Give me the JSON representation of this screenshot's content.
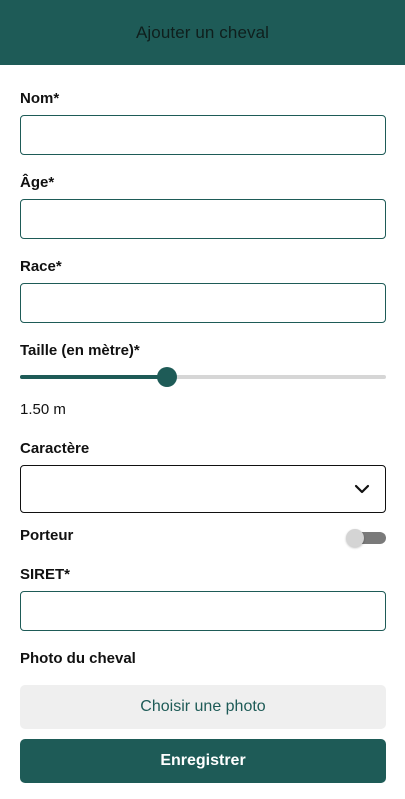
{
  "header": {
    "title": "Ajouter un cheval"
  },
  "form": {
    "name_label": "Nom*",
    "name_value": "",
    "age_label": "Âge*",
    "age_value": "",
    "breed_label": "Race*",
    "breed_value": "",
    "height_label": "Taille (en mètre)*",
    "height_fraction": 0.403,
    "height_value_text": "1.50 m",
    "character_label": "Caractère",
    "character_selected": "",
    "porteur_label": "Porteur",
    "porteur_on": false,
    "siret_label": "SIRET*",
    "siret_value": "",
    "photo_label": "Photo du cheval",
    "photo_button_label": "Choisir une photo",
    "save_button_label": "Enregistrer"
  },
  "icons": {
    "select_chevron": "chevron-down-icon"
  },
  "colors": {
    "primary": "#1e5b57",
    "track": "#d6d6d6",
    "photo_button_bg": "#efefef"
  }
}
